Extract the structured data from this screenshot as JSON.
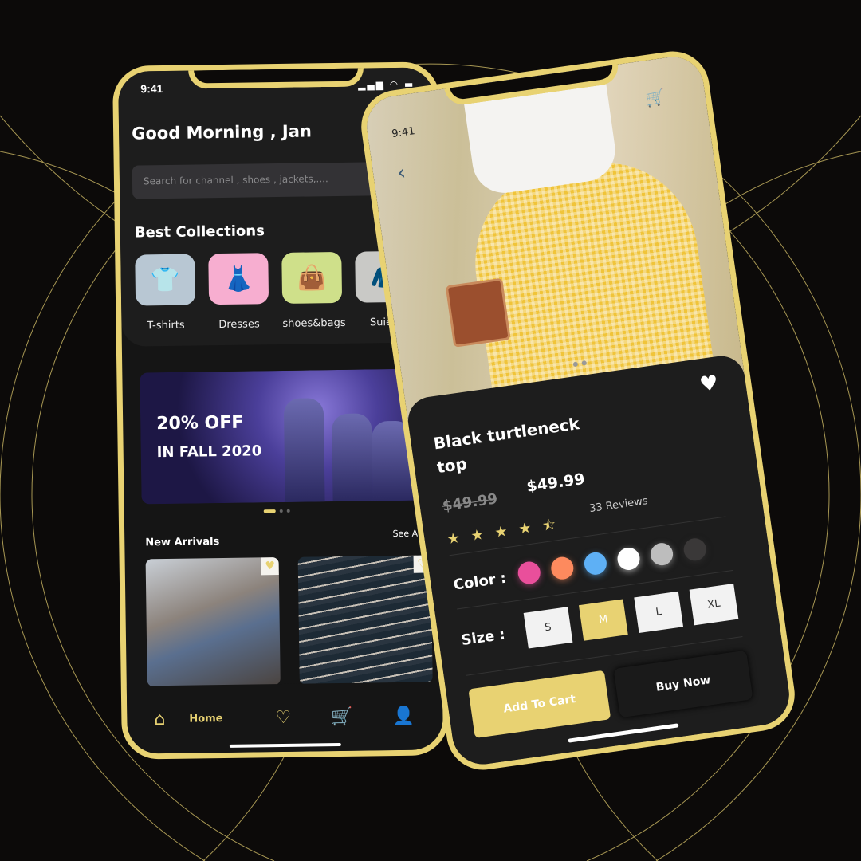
{
  "colors": {
    "accent": "#e8d272",
    "background": "#0c0a09",
    "panel": "#1d1d1d"
  },
  "home": {
    "status_time": "9:41",
    "greeting": "Good Morning , Jan",
    "search_placeholder": "Search for channel , shoes , jackets,....",
    "best_collections": "Best Collections",
    "categories": [
      {
        "label": "T-shirts",
        "icon": "tshirt-icon",
        "bg": "#b8c7d3"
      },
      {
        "label": "Dresses",
        "icon": "dress-icon",
        "bg": "#f7aed0"
      },
      {
        "label": "shoes&bags",
        "icon": "bag-shoe-icon",
        "bg": "#cfe08a"
      },
      {
        "label": "Suiets",
        "icon": "jacket-icon",
        "bg": "#c9c9c6"
      }
    ],
    "banner": {
      "line1": "20% OFF",
      "line2": "IN  FALL 2020"
    },
    "new_arrivals": "New Arrivals",
    "see_all": "See All",
    "nav": {
      "home": "Home"
    }
  },
  "product": {
    "status_time": "9:41",
    "title": "Black turtleneck top",
    "old_price": "$49.99",
    "price": "$49.99",
    "rating": 4.5,
    "reviews": "33 Reviews",
    "color_label": "Color  :",
    "colors": [
      "#e94f9b",
      "#fd8a5e",
      "#5eb0f5",
      "#ffffff",
      "#bdbdbd",
      "#3a3838"
    ],
    "size_label": "Size  :",
    "sizes": [
      "S",
      "M",
      "L",
      "XL"
    ],
    "selected_size": "M",
    "add_to_cart": "Add To Cart",
    "buy_now": "Buy Now"
  }
}
